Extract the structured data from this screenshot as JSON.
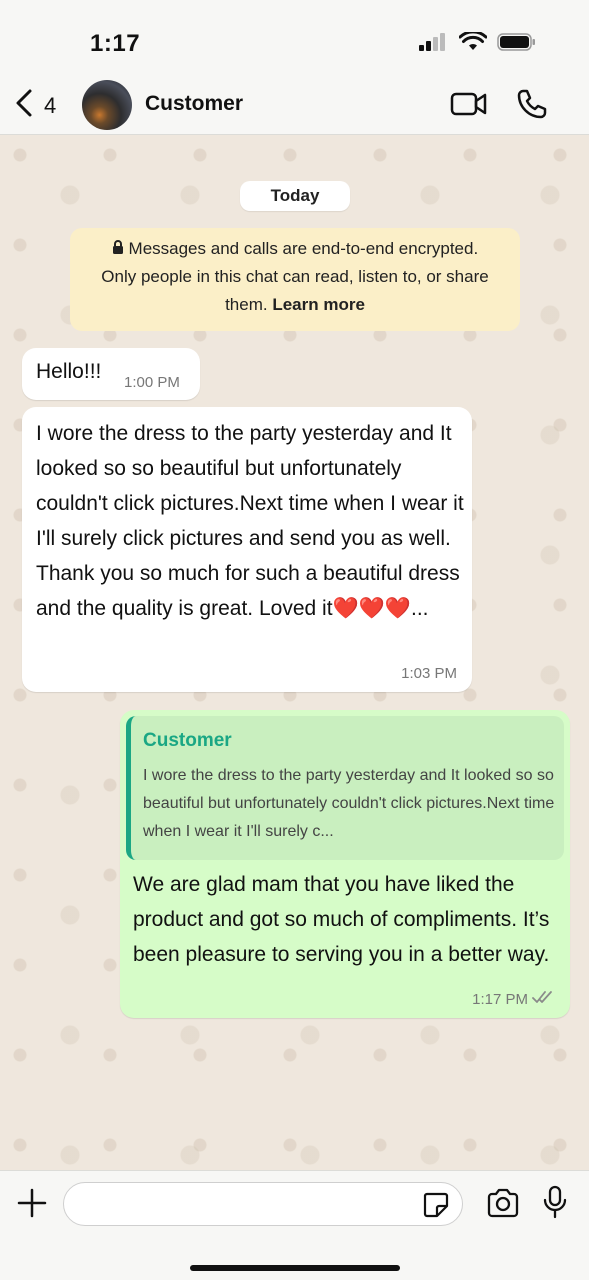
{
  "status_bar": {
    "time": "1:17"
  },
  "header": {
    "back_count": "4",
    "contact_name": "Customer"
  },
  "chat": {
    "date_chip": "Today",
    "encryption_notice": {
      "line1": "Messages and calls are end-to-end encrypted.",
      "line2": "Only people in this chat can read, listen to, or share",
      "line3_text": "them.",
      "line3_link": "Learn more"
    },
    "messages": [
      {
        "direction": "incoming",
        "text": "Hello!!!",
        "time": "1:00 PM"
      },
      {
        "direction": "incoming",
        "text": "I wore the dress to the party yesterday and It looked so so beautiful but unfortunately couldn't click pictures.Next time when I wear it I'll surely click pictures and send you as well. Thank you so much for such a beautiful dress and the quality is great. Loved it",
        "hearts": "❤️❤️❤️",
        "ellipsis": "...",
        "time": "1:03 PM"
      },
      {
        "direction": "outgoing",
        "quote_name": "Customer",
        "quote_text": "I wore the dress to the party yesterday and It looked so so beautiful but unfortunately couldn't click pictures.Next time when I wear it I'll surely c...",
        "text": "We are glad mam that you have liked the product and got so much of compliments. It’s been pleasure to serving you in a better way.",
        "time": "1:17 PM",
        "status": "read-double-check-icon"
      }
    ]
  },
  "composer": {
    "placeholder": ""
  },
  "colors": {
    "incoming_bubble": "#ffffff",
    "outgoing_bubble": "#d6fcc8",
    "quote_accent": "#1aa784",
    "notice_bg": "#fbefc8",
    "hearts": "#e1222c"
  }
}
